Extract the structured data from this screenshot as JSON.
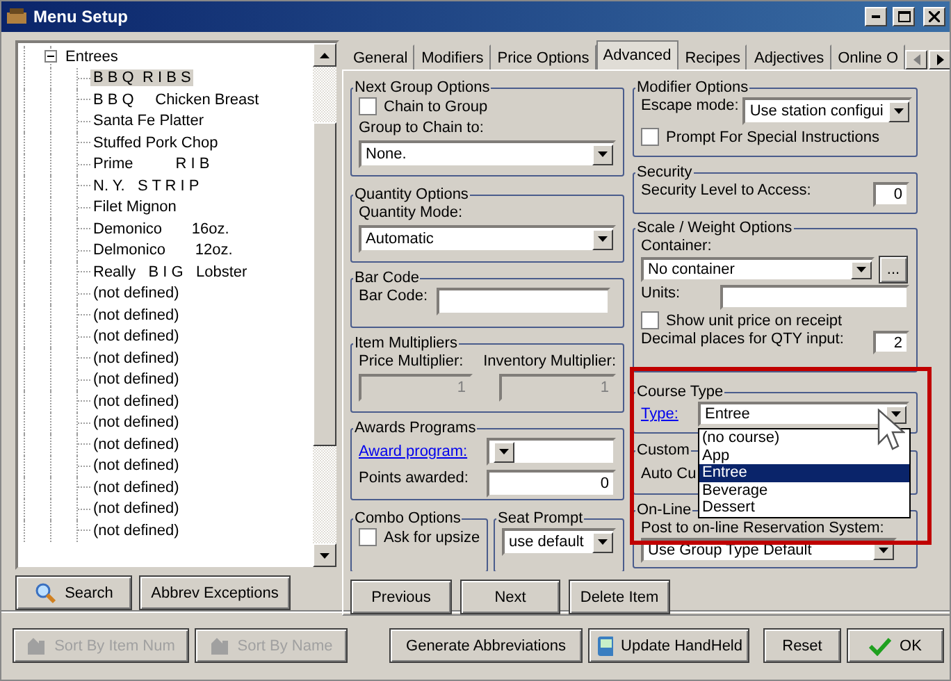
{
  "window": {
    "title": "Menu Setup"
  },
  "tree": {
    "label": "Entrees",
    "expanded": true,
    "children": [
      {
        "label": "B B Q  R I B S",
        "selected": true
      },
      {
        "label": "B B Q     Chicken Breast",
        "selected": false
      },
      {
        "label": "Santa Fe Platter",
        "selected": false
      },
      {
        "label": "Stuffed Pork Chop",
        "selected": false
      },
      {
        "label": "Prime          R I B",
        "selected": false
      },
      {
        "label": "N. Y.   S T R I P",
        "selected": false
      },
      {
        "label": "Filet Mignon",
        "selected": false
      },
      {
        "label": "Demonico       16oz.",
        "selected": false
      },
      {
        "label": "Delmonico       12oz.",
        "selected": false
      },
      {
        "label": "Really   B I G   Lobster",
        "selected": false
      },
      {
        "label": "(not defined)",
        "selected": false
      },
      {
        "label": "(not defined)",
        "selected": false
      },
      {
        "label": "(not defined)",
        "selected": false
      },
      {
        "label": "(not defined)",
        "selected": false
      },
      {
        "label": "(not defined)",
        "selected": false
      },
      {
        "label": "(not defined)",
        "selected": false
      },
      {
        "label": "(not defined)",
        "selected": false
      },
      {
        "label": "(not defined)",
        "selected": false
      },
      {
        "label": "(not defined)",
        "selected": false
      },
      {
        "label": "(not defined)",
        "selected": false
      },
      {
        "label": "(not defined)",
        "selected": false
      },
      {
        "label": "(not defined)",
        "selected": false
      }
    ]
  },
  "left_buttons": [
    "Search",
    "Abbrev Exceptions"
  ],
  "tabs": [
    {
      "label": "General",
      "selected": false
    },
    {
      "label": "Modifiers",
      "selected": false
    },
    {
      "label": "Price Options",
      "selected": false
    },
    {
      "label": "Advanced",
      "selected": true
    },
    {
      "label": "Recipes",
      "selected": false
    },
    {
      "label": "Adjectives",
      "selected": false
    },
    {
      "label": "Online O",
      "selected": false
    }
  ],
  "next_group": {
    "title": "Next Group Options",
    "chain": {
      "label": "Chain to Group",
      "checked": false
    },
    "group_label": "Group to Chain to:",
    "group_value": "None."
  },
  "quantity": {
    "title": "Quantity Options",
    "label": "Quantity Mode:",
    "value": "Automatic"
  },
  "bar_code": {
    "title": "Bar Code",
    "label": "Bar Code:"
  },
  "multipliers": {
    "title": "Item Multipliers",
    "price_label": "Price Multiplier:",
    "price_value": "1",
    "inventory_label": "Inventory Multiplier:",
    "inventory_value": "1"
  },
  "awards": {
    "title": "Awards Programs",
    "program_label": "Award program:",
    "points_label": "Points awarded:",
    "points_value": "0"
  },
  "combo": {
    "title": "Combo Options",
    "upsize": {
      "label": "Ask for upsize",
      "checked": false
    }
  },
  "seat_prompt": {
    "title": "Seat Prompt",
    "value": "use default"
  },
  "modifier_options": {
    "title": "Modifier Options",
    "escape_label": "Escape mode:",
    "escape_value": "Use station configui",
    "special": {
      "label": "Prompt For Special Instructions",
      "checked": false
    }
  },
  "security": {
    "title": "Security",
    "label": "Security Level to Access:",
    "value": "0"
  },
  "scale": {
    "title": "Scale / Weight Options",
    "container_label": "Container:",
    "container_value": "No container",
    "more": "...",
    "units_label": "Units:",
    "unit_price": {
      "label": "Show unit price on receipt",
      "checked": false
    },
    "decimal_label": "Decimal places for QTY input:",
    "decimal_value": "2"
  },
  "course_type": {
    "title": "Course Type",
    "type_label": "Type:",
    "value": "Entree",
    "expanded": true,
    "options": [
      {
        "label": "(no course)",
        "selected": false
      },
      {
        "label": "App",
        "selected": false
      },
      {
        "label": "Entree",
        "selected": true
      },
      {
        "label": "Beverage",
        "selected": false
      },
      {
        "label": "Dessert",
        "selected": false
      }
    ]
  },
  "custom": {
    "title": "Custom",
    "label": "Auto Cu"
  },
  "online": {
    "title": "On-Line",
    "label": "Post to on-line Reservation System:",
    "value": "Use Group Type Default"
  },
  "nav_buttons": [
    "Previous",
    "Next",
    "Delete Item"
  ],
  "bottom_buttons": [
    {
      "label": "Sort By Item Num",
      "disabled": true,
      "kind": "sort-num"
    },
    {
      "label": "Sort By Name",
      "disabled": true,
      "kind": "sort-name"
    },
    {
      "label": "Generate Abbreviations",
      "disabled": false,
      "kind": "plain"
    },
    {
      "label": "Update HandHeld",
      "disabled": false,
      "kind": "handheld"
    },
    {
      "label": "Reset",
      "disabled": false,
      "kind": "plain"
    },
    {
      "label": "OK",
      "disabled": false,
      "kind": "ok"
    }
  ]
}
